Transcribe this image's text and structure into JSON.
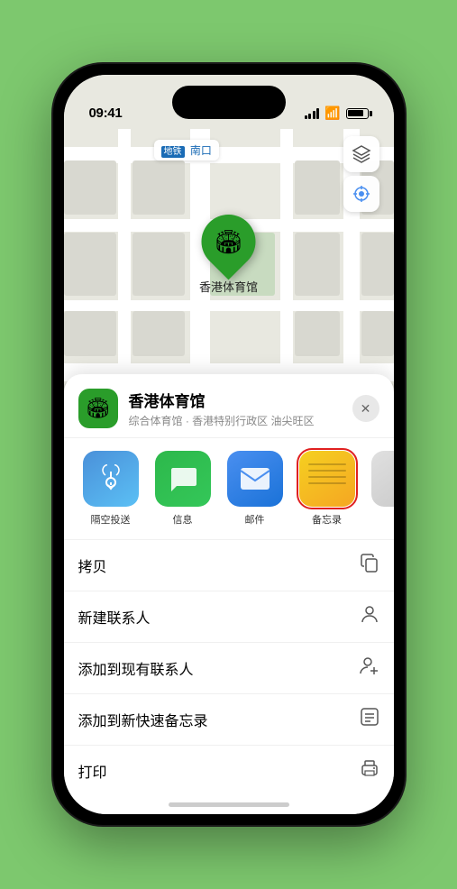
{
  "status_bar": {
    "time": "09:41",
    "location_arrow": "▶"
  },
  "map": {
    "badge_text": "南口",
    "pin_emoji": "🏟",
    "pin_label": "香港体育馆"
  },
  "map_controls": {
    "layers_label": "layers",
    "location_label": "location"
  },
  "bottom_sheet": {
    "location_emoji": "🏟",
    "name": "香港体育馆",
    "detail": "综合体育馆 · 香港特别行政区 油尖旺区",
    "close_label": "✕"
  },
  "share_items": [
    {
      "id": "airdrop",
      "label": "隔空投送",
      "type": "airdrop"
    },
    {
      "id": "messages",
      "label": "信息",
      "type": "messages"
    },
    {
      "id": "mail",
      "label": "邮件",
      "type": "mail"
    },
    {
      "id": "notes",
      "label": "备忘录",
      "type": "notes",
      "selected": true
    },
    {
      "id": "more",
      "label": "提",
      "type": "more"
    }
  ],
  "actions": [
    {
      "id": "copy",
      "label": "拷贝",
      "icon": "copy"
    },
    {
      "id": "new-contact",
      "label": "新建联系人",
      "icon": "person"
    },
    {
      "id": "add-contact",
      "label": "添加到现有联系人",
      "icon": "person-add"
    },
    {
      "id": "quick-note",
      "label": "添加到新快速备忘录",
      "icon": "note"
    },
    {
      "id": "print",
      "label": "打印",
      "icon": "print"
    }
  ]
}
